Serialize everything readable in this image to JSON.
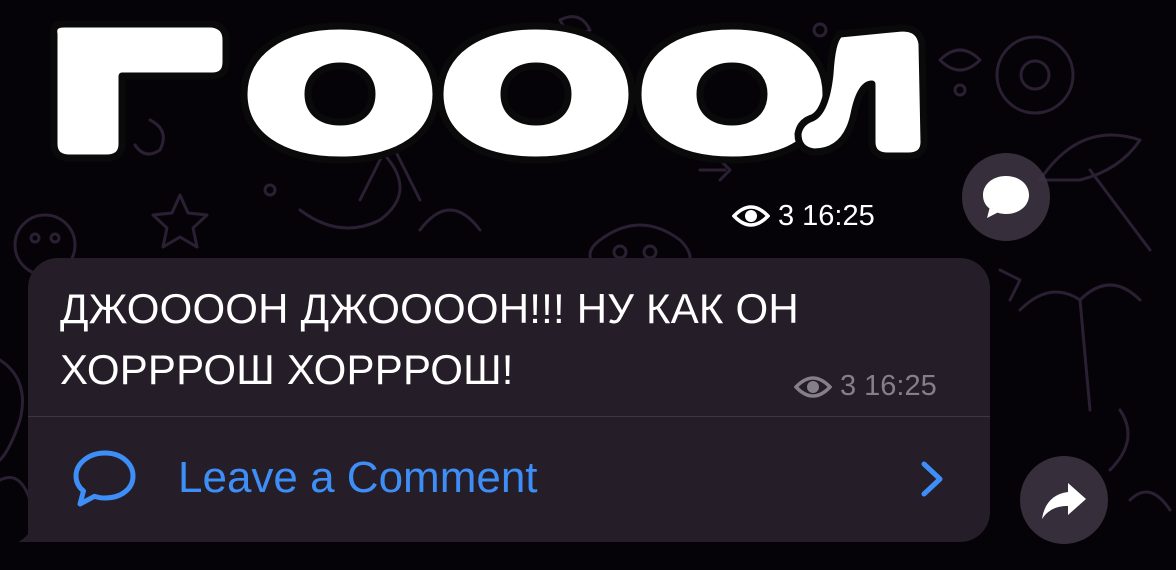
{
  "sticker": {
    "text": "ГОООЛ"
  },
  "sticker_meta": {
    "views": "3",
    "time": "16:25"
  },
  "message": {
    "line1": "ДЖООООН ДЖООООН!!! НУ КАК ОН",
    "line2": "ХОРРРОШ ХОРРРОШ!",
    "views": "3",
    "time": "16:25"
  },
  "comments": {
    "label": "Leave a Comment"
  },
  "icons": {
    "views": "eye-icon",
    "comment": "speech-bubble-icon",
    "share": "share-arrow-icon",
    "chevron": "chevron-right-icon"
  },
  "colors": {
    "background": "#050307",
    "bubble": "#251d27",
    "accent": "#3e8ef7",
    "meta_text": "#857f88"
  }
}
